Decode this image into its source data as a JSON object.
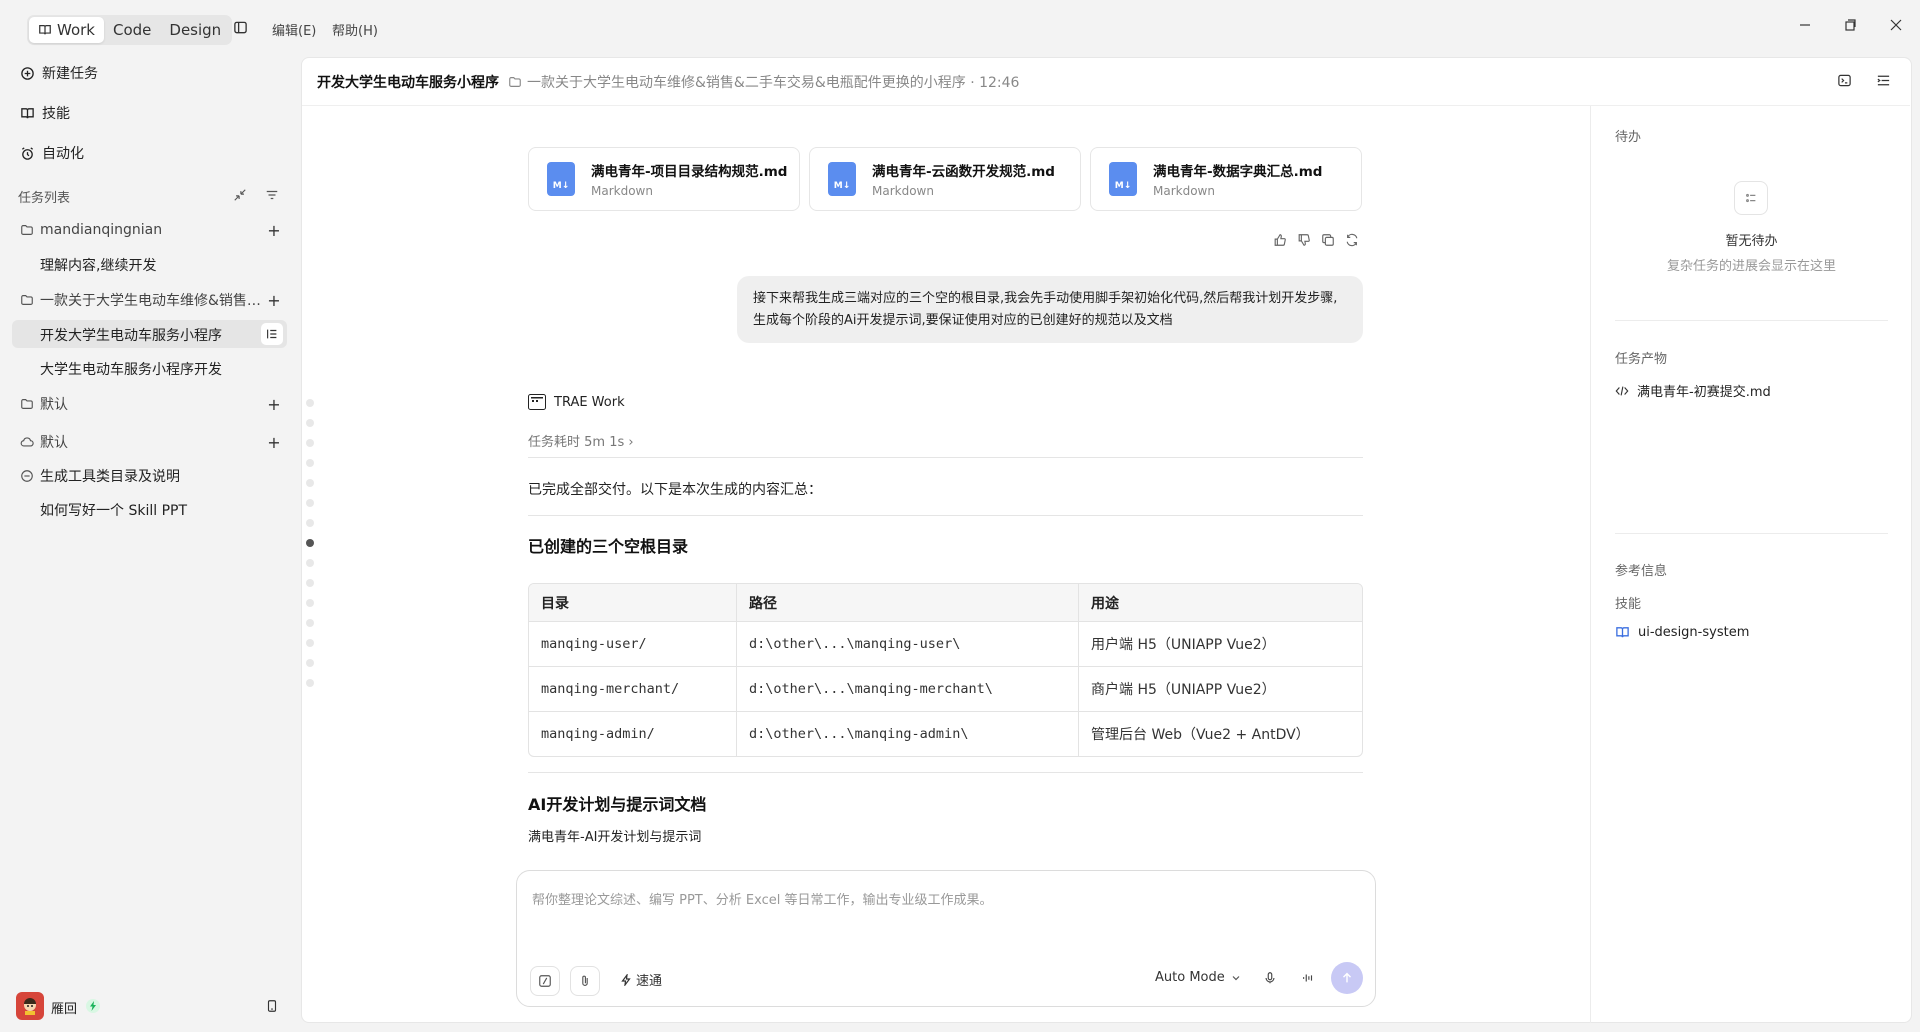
{
  "topbar": {
    "modes": [
      {
        "label": "Work"
      },
      {
        "label": "Code"
      },
      {
        "label": "Design"
      }
    ],
    "menus": [
      {
        "label": "编辑(E)"
      },
      {
        "label": "帮助(H)"
      }
    ]
  },
  "sidebar": {
    "nav": [
      {
        "label": "新建任务",
        "icon": "plus-circle-icon"
      },
      {
        "label": "技能",
        "icon": "book-icon"
      },
      {
        "label": "自动化",
        "icon": "alarm-icon"
      }
    ],
    "tasks_header": "任务列表",
    "groups": [
      {
        "label": "mandianqingnian",
        "items": [
          "理解内容,继续开发"
        ]
      },
      {
        "label": "一款关于大学生电动车维修&销售&二手车交易&电瓶配件更换的小程序",
        "items": [
          "开发大学生电动车服务小程序",
          "大学生电动车服务小程序开发"
        ]
      },
      {
        "label": "默认",
        "items": []
      },
      {
        "label": "默认",
        "items": []
      },
      {
        "label": "生成工具类目录及说明",
        "items": [
          "如何写好一个 Skill PPT"
        ]
      }
    ],
    "user_name": "雁回"
  },
  "header": {
    "title": "开发大学生电动车服务小程序",
    "subtitle": "一款关于大学生电动车维修&销售&二手车交易&电瓶配件更换的小程序 · 12:46"
  },
  "files": [
    {
      "name": "满电青年-项目目录结构规范.md",
      "type": "Markdown"
    },
    {
      "name": "满电青年-云函数开发规范.md",
      "type": "Markdown"
    },
    {
      "name": "满电青年-数据字典汇总.md",
      "type": "Markdown"
    }
  ],
  "user_message": "接下来帮我生成三端对应的三个空的根目录,我会先手动使用脚手架初始化代码,然后帮我计划开发步骤,生成每个阶段的Ai开发提示词,要保证使用对应的已创建好的规范以及文档",
  "assistant": {
    "brand": "TRAE Work",
    "elapsed": "任务耗时 5m 1s",
    "summary": "已完成全部交付。以下是本次生成的内容汇总：",
    "section1": "已创建的三个空根目录",
    "table_headers": [
      "目录",
      "路径",
      "用途"
    ],
    "table_rows": [
      [
        "manqing-user/",
        "d:\\other\\...\\manqing-user\\",
        "用户端 H5（UNIAPP Vue2）"
      ],
      [
        "manqing-merchant/",
        "d:\\other\\...\\manqing-merchant\\",
        "商户端 H5（UNIAPP Vue2）"
      ],
      [
        "manqing-admin/",
        "d:\\other\\...\\manqing-admin\\",
        "管理后台 Web（Vue2 + AntDV）"
      ]
    ],
    "section2": "AI开发计划与提示词文档",
    "section2_text": "满电青年-AI开发计划与提示词"
  },
  "composer": {
    "placeholder": "帮你整理论文综述、编写 PPT、分析 Excel 等日常工作，输出专业级工作成果。",
    "speed_label": "速通",
    "mode_label": "Auto Mode"
  },
  "right_panel": {
    "todo_header": "待办",
    "todo_empty_title": "暂无待办",
    "todo_empty_desc": "复杂任务的进展会显示在这里",
    "outputs_header": "任务产物",
    "output_file": "满电青年-初赛提交.md",
    "ref_header": "参考信息",
    "skills_header": "技能",
    "skill_item": "ui-design-system"
  }
}
